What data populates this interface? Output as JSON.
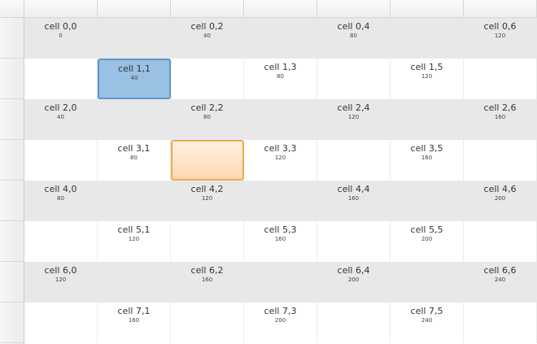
{
  "colors": {
    "selected_cell_fill": "#99c1e3",
    "selected_cell_border": "#5c98cf",
    "highlight_cell_fill": "#ffe2c4",
    "highlight_cell_border": "#f0a851",
    "even_row_bg": "#e8e8e8",
    "odd_row_bg": "#ffffff"
  },
  "grid": {
    "columns": 7,
    "selected_cell": "cell 1,1",
    "highlighted_cell_row": 3,
    "highlighted_cell_col": 2,
    "rows": [
      {
        "cells": [
          {
            "title": "cell 0,0",
            "value": "0"
          },
          {
            "title": "",
            "value": ""
          },
          {
            "title": "cell 0,2",
            "value": "40"
          },
          {
            "title": "",
            "value": ""
          },
          {
            "title": "cell 0,4",
            "value": "80"
          },
          {
            "title": "",
            "value": ""
          },
          {
            "title": "cell 0,6",
            "value": "120"
          }
        ]
      },
      {
        "cells": [
          {
            "title": "",
            "value": ""
          },
          {
            "title": "cell 1,1",
            "value": "40"
          },
          {
            "title": "",
            "value": ""
          },
          {
            "title": "cell 1,3",
            "value": "80"
          },
          {
            "title": "",
            "value": ""
          },
          {
            "title": "cell 1,5",
            "value": "120"
          },
          {
            "title": "",
            "value": ""
          }
        ]
      },
      {
        "cells": [
          {
            "title": "cell 2,0",
            "value": "40"
          },
          {
            "title": "",
            "value": ""
          },
          {
            "title": "cell 2,2",
            "value": "80"
          },
          {
            "title": "",
            "value": ""
          },
          {
            "title": "cell 2,4",
            "value": "120"
          },
          {
            "title": "",
            "value": ""
          },
          {
            "title": "cell 2,6",
            "value": "160"
          }
        ]
      },
      {
        "cells": [
          {
            "title": "",
            "value": ""
          },
          {
            "title": "cell 3,1",
            "value": "80"
          },
          {
            "title": "",
            "value": ""
          },
          {
            "title": "cell 3,3",
            "value": "120"
          },
          {
            "title": "",
            "value": ""
          },
          {
            "title": "cell 3,5",
            "value": "160"
          },
          {
            "title": "",
            "value": ""
          }
        ]
      },
      {
        "cells": [
          {
            "title": "cell 4,0",
            "value": "80"
          },
          {
            "title": "",
            "value": ""
          },
          {
            "title": "cell 4,2",
            "value": "120"
          },
          {
            "title": "",
            "value": ""
          },
          {
            "title": "cell 4,4",
            "value": "160"
          },
          {
            "title": "",
            "value": ""
          },
          {
            "title": "cell 4,6",
            "value": "200"
          }
        ]
      },
      {
        "cells": [
          {
            "title": "",
            "value": ""
          },
          {
            "title": "cell 5,1",
            "value": "120"
          },
          {
            "title": "",
            "value": ""
          },
          {
            "title": "cell 5,3",
            "value": "160"
          },
          {
            "title": "",
            "value": ""
          },
          {
            "title": "cell 5,5",
            "value": "200"
          },
          {
            "title": "",
            "value": ""
          }
        ]
      },
      {
        "cells": [
          {
            "title": "cell 6,0",
            "value": "120"
          },
          {
            "title": "",
            "value": ""
          },
          {
            "title": "cell 6,2",
            "value": "160"
          },
          {
            "title": "",
            "value": ""
          },
          {
            "title": "cell 6,4",
            "value": "200"
          },
          {
            "title": "",
            "value": ""
          },
          {
            "title": "cell 6,6",
            "value": "240"
          }
        ]
      },
      {
        "cells": [
          {
            "title": "",
            "value": ""
          },
          {
            "title": "cell 7,1",
            "value": "160"
          },
          {
            "title": "",
            "value": ""
          },
          {
            "title": "cell 7,3",
            "value": "200"
          },
          {
            "title": "",
            "value": ""
          },
          {
            "title": "cell 7,5",
            "value": "240"
          },
          {
            "title": "",
            "value": ""
          }
        ]
      }
    ]
  }
}
